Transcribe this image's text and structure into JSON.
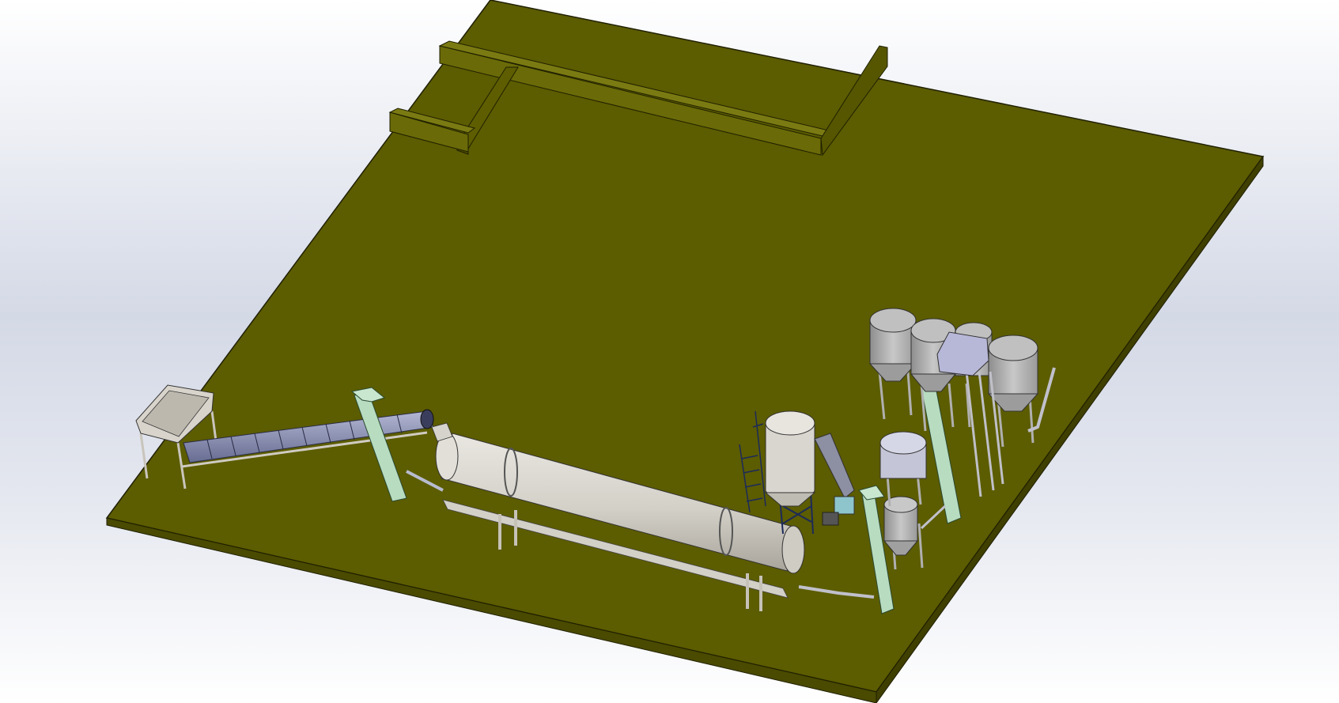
{
  "scene": {
    "description_visible_text": "",
    "colors": {
      "background_top": "#ffffff",
      "background_mid": "#d4d9e6",
      "background_bottom": "#ffffff",
      "floor_top": "#5c5c00",
      "floor_edge": "#4a4a00",
      "floor_outline": "#1f1f00",
      "wall_face": "#6a6a08",
      "wall_dark": "#4d4d00",
      "equipment_gray": "#d6d3cc",
      "equipment_shadow": "#a8a49b",
      "tank_gray": "#b9b9b9",
      "elevator_green": "#b8dcc0",
      "conveyor_blue": "#8a8fb2",
      "frame_navy": "#1c2a5a",
      "hopper_box": "#b7b7d8"
    }
  }
}
